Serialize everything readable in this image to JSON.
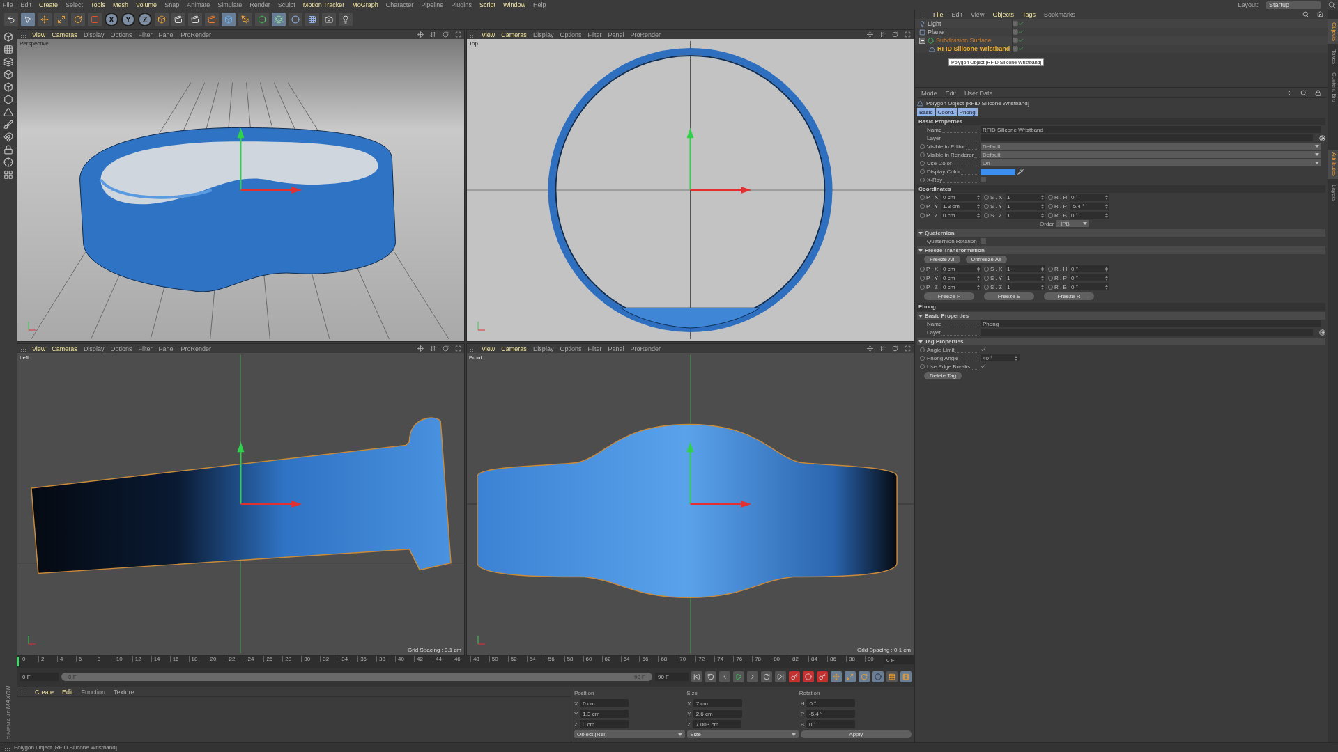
{
  "menu_bar": [
    {
      "label": "File",
      "highlighted": false
    },
    {
      "label": "Edit",
      "highlighted": false
    },
    {
      "label": "Create",
      "highlighted": true
    },
    {
      "label": "Select",
      "highlighted": false
    },
    {
      "label": "Tools",
      "highlighted": true
    },
    {
      "label": "Mesh",
      "highlighted": true
    },
    {
      "label": "Volume",
      "highlighted": true
    },
    {
      "label": "Snap",
      "highlighted": false
    },
    {
      "label": "Animate",
      "highlighted": false
    },
    {
      "label": "Simulate",
      "highlighted": false
    },
    {
      "label": "Render",
      "highlighted": false
    },
    {
      "label": "Sculpt",
      "highlighted": false
    },
    {
      "label": "Motion Tracker",
      "highlighted": true
    },
    {
      "label": "MoGraph",
      "highlighted": true
    },
    {
      "label": "Character",
      "highlighted": false
    },
    {
      "label": "Pipeline",
      "highlighted": false
    },
    {
      "label": "Plugins",
      "highlighted": false
    },
    {
      "label": "Script",
      "highlighted": true
    },
    {
      "label": "Window",
      "highlighted": true
    },
    {
      "label": "Help",
      "highlighted": false
    }
  ],
  "layout": {
    "label": "Layout:",
    "value": "Startup"
  },
  "toolbar": {
    "axis_buttons": [
      "X",
      "Y",
      "Z"
    ]
  },
  "viewports": [
    {
      "kind": "perspective",
      "camera": "Perspective",
      "menu": [
        {
          "label": "View",
          "highlighted": true
        },
        {
          "label": "Cameras",
          "highlighted": true
        },
        {
          "label": "Display",
          "highlighted": false
        },
        {
          "label": "Options",
          "highlighted": false
        },
        {
          "label": "Filter",
          "highlighted": false
        },
        {
          "label": "Panel",
          "highlighted": false
        },
        {
          "label": "ProRender",
          "highlighted": false
        }
      ]
    },
    {
      "kind": "top",
      "camera": "Top",
      "menu": [
        {
          "label": "View",
          "highlighted": true
        },
        {
          "label": "Cameras",
          "highlighted": true
        },
        {
          "label": "Display",
          "highlighted": false
        },
        {
          "label": "Options",
          "highlighted": false
        },
        {
          "label": "Filter",
          "highlighted": false
        },
        {
          "label": "Panel",
          "highlighted": false
        },
        {
          "label": "ProRender",
          "highlighted": false
        }
      ]
    },
    {
      "kind": "left",
      "camera": "Left",
      "grid_spacing": "Grid Spacing : 0.1 cm",
      "menu": [
        {
          "label": "View",
          "highlighted": true
        },
        {
          "label": "Cameras",
          "highlighted": true
        },
        {
          "label": "Display",
          "highlighted": false
        },
        {
          "label": "Options",
          "highlighted": false
        },
        {
          "label": "Filter",
          "highlighted": false
        },
        {
          "label": "Panel",
          "highlighted": false
        },
        {
          "label": "ProRender",
          "highlighted": false
        }
      ]
    },
    {
      "kind": "front",
      "camera": "Front",
      "grid_spacing": "Grid Spacing : 0.1 cm",
      "menu": [
        {
          "label": "View",
          "highlighted": true
        },
        {
          "label": "Cameras",
          "highlighted": true
        },
        {
          "label": "Display",
          "highlighted": false
        },
        {
          "label": "Options",
          "highlighted": false
        },
        {
          "label": "Filter",
          "highlighted": false
        },
        {
          "label": "Panel",
          "highlighted": false
        },
        {
          "label": "ProRender",
          "highlighted": false
        }
      ]
    }
  ],
  "timeline": {
    "ticks": [
      "0",
      "2",
      "4",
      "6",
      "8",
      "10",
      "12",
      "14",
      "16",
      "18",
      "20",
      "22",
      "24",
      "26",
      "28",
      "30",
      "32",
      "34",
      "36",
      "38",
      "40",
      "42",
      "44",
      "46",
      "48",
      "50",
      "52",
      "54",
      "56",
      "58",
      "60",
      "62",
      "64",
      "66",
      "68",
      "70",
      "72",
      "74",
      "76",
      "78",
      "80",
      "82",
      "84",
      "86",
      "88",
      "90"
    ],
    "current_frame": "0 F",
    "start_field": "0 F",
    "slider_start": "0 F",
    "slider_end": "90 F",
    "end_field": "90 F"
  },
  "material_manager": {
    "menu": [
      {
        "label": "Create",
        "highlighted": true
      },
      {
        "label": "Edit",
        "highlighted": true
      },
      {
        "label": "Function",
        "highlighted": false
      },
      {
        "label": "Texture",
        "highlighted": false
      }
    ]
  },
  "brand": [
    "MAXON",
    "CINEMA 4D"
  ],
  "coordinates": {
    "headers": [
      "Position",
      "Size",
      "Rotation"
    ],
    "rows": [
      {
        "cells": [
          {
            "axis": "X",
            "value": "0 cm"
          },
          {
            "axis": "X",
            "value": "7 cm"
          },
          {
            "axis": "H",
            "value": "0 °"
          }
        ]
      },
      {
        "cells": [
          {
            "axis": "Y",
            "value": "1.3 cm"
          },
          {
            "axis": "Y",
            "value": "2.6 cm"
          },
          {
            "axis": "P",
            "value": "-5.4 °"
          }
        ]
      },
      {
        "cells": [
          {
            "axis": "Z",
            "value": "0 cm"
          },
          {
            "axis": "Z",
            "value": "7.003 cm"
          },
          {
            "axis": "B",
            "value": "0 °"
          }
        ]
      }
    ],
    "dropdowns": [
      "Object (Rel)",
      "Size"
    ],
    "apply": "Apply"
  },
  "object_manager": {
    "menu": [
      {
        "label": "File",
        "highlighted": true
      },
      {
        "label": "Edit",
        "highlighted": false
      },
      {
        "label": "View",
        "highlighted": false
      },
      {
        "label": "Objects",
        "highlighted": true
      },
      {
        "label": "Tags",
        "highlighted": true
      },
      {
        "label": "Bookmarks",
        "highlighted": false
      }
    ],
    "objects": [
      {
        "name": "Light",
        "kind": "light",
        "highlighted": false,
        "selected": false
      },
      {
        "name": "Plane",
        "kind": "plane",
        "highlighted": false,
        "selected": false
      },
      {
        "name": "Subdivision Surface",
        "kind": "subdivision",
        "highlighted": true,
        "selected": false,
        "expanded": true,
        "children": [
          {
            "name": "RFID Silicone Wristband",
            "kind": "polygon",
            "highlighted": false,
            "selected": true
          }
        ]
      }
    ],
    "tooltip": "Polygon Object [RFID Silicone Wristband]"
  },
  "attributes": {
    "menu": [
      "Mode",
      "Edit",
      "User Data"
    ],
    "title": "Polygon Object [RFID Silicone Wristband]",
    "tabs": [
      {
        "label": "Basic",
        "selected": true
      },
      {
        "label": "Coord.",
        "selected": true
      },
      {
        "label": "Phong",
        "selected": true
      }
    ],
    "sections": [
      {
        "kind": "header",
        "title": "Basic Properties",
        "rows": [
          {
            "kind": "text",
            "label": "Name",
            "value": "RFID Silicone Wristband"
          },
          {
            "kind": "link",
            "label": "Layer"
          },
          {
            "kind": "dropdown",
            "label": "Visible in Editor",
            "value": "Default"
          },
          {
            "kind": "dropdown",
            "label": "Visible in Renderer",
            "value": "Default"
          },
          {
            "kind": "dropdown",
            "label": "Use Color",
            "value": "On"
          },
          {
            "kind": "color",
            "label": "Display Color",
            "color": "#3d8ef0"
          },
          {
            "kind": "checkbox",
            "label": "X-Ray",
            "checked": false
          }
        ]
      },
      {
        "kind": "header",
        "title": "Coordinates",
        "rows": [
          {
            "kind": "grid",
            "cells": [
              {
                "label": "P . X",
                "value": "0 cm"
              },
              {
                "label": "S . X",
                "value": "1"
              },
              {
                "label": "R . H",
                "value": "0 °"
              },
              {
                "label": "P . Y",
                "value": "1.3 cm"
              },
              {
                "label": "S . Y",
                "value": "1"
              },
              {
                "label": "R . P",
                "value": "-5.4 °"
              },
              {
                "label": "P . Z",
                "value": "0 cm"
              },
              {
                "label": "S . Z",
                "value": "1"
              },
              {
                "label": "R . B",
                "value": "0 °"
              }
            ]
          },
          {
            "kind": "order",
            "label": "Order",
            "value": "HPB"
          }
        ]
      },
      {
        "kind": "fold",
        "title": "Quaternion",
        "expanded": true,
        "rows": [
          {
            "kind": "flagbox",
            "label": "Quaternion Rotation",
            "checked": false
          }
        ]
      },
      {
        "kind": "fold",
        "title": "Freeze Transformation",
        "expanded": true,
        "rows": [
          {
            "kind": "buttons",
            "buttons": [
              "Freeze All",
              "Unfreeze All"
            ]
          },
          {
            "kind": "grid",
            "cells": [
              {
                "label": "P . X",
                "value": "0 cm"
              },
              {
                "label": "S . X",
                "value": "1"
              },
              {
                "label": "R . H",
                "value": "0 °"
              },
              {
                "label": "P . Y",
                "value": "0 cm"
              },
              {
                "label": "S . Y",
                "value": "1"
              },
              {
                "label": "R . P",
                "value": "0 °"
              },
              {
                "label": "P . Z",
                "value": "0 cm"
              },
              {
                "label": "S . Z",
                "value": "1"
              },
              {
                "label": "R . B",
                "value": "0 °"
              }
            ]
          },
          {
            "kind": "wide_buttons",
            "buttons": [
              "Freeze P",
              "Freeze S",
              "Freeze R"
            ]
          }
        ]
      },
      {
        "kind": "header",
        "title": "Phong"
      },
      {
        "kind": "fold",
        "title": "Basic Properties",
        "expanded": true,
        "rows": [
          {
            "kind": "text",
            "label": "Name",
            "value": "Phong"
          },
          {
            "kind": "link",
            "label": "Layer"
          }
        ]
      },
      {
        "kind": "fold",
        "title": "Tag Properties",
        "expanded": true,
        "rows": [
          {
            "kind": "checkbox",
            "label": "Angle Limit",
            "checked": true
          },
          {
            "kind": "number",
            "label": "Phong Angle",
            "value": "40 °"
          },
          {
            "kind": "checkbox",
            "label": "Use Edge Breaks",
            "checked": true
          }
        ]
      },
      {
        "kind": "plain",
        "rows": [
          {
            "kind": "buttons",
            "buttons": [
              "Delete Tag"
            ]
          }
        ]
      }
    ]
  },
  "side_tabs_top": [
    {
      "label": "Objects",
      "selected": true
    },
    {
      "label": "Takes",
      "selected": false
    },
    {
      "label": "Content Bro",
      "selected": false
    }
  ],
  "side_tabs_bottom": [
    {
      "label": "Attributes",
      "selected": true
    },
    {
      "label": "Layers",
      "selected": false
    }
  ],
  "status_bar": "Polygon Object [RFID Silicone Wristband]"
}
